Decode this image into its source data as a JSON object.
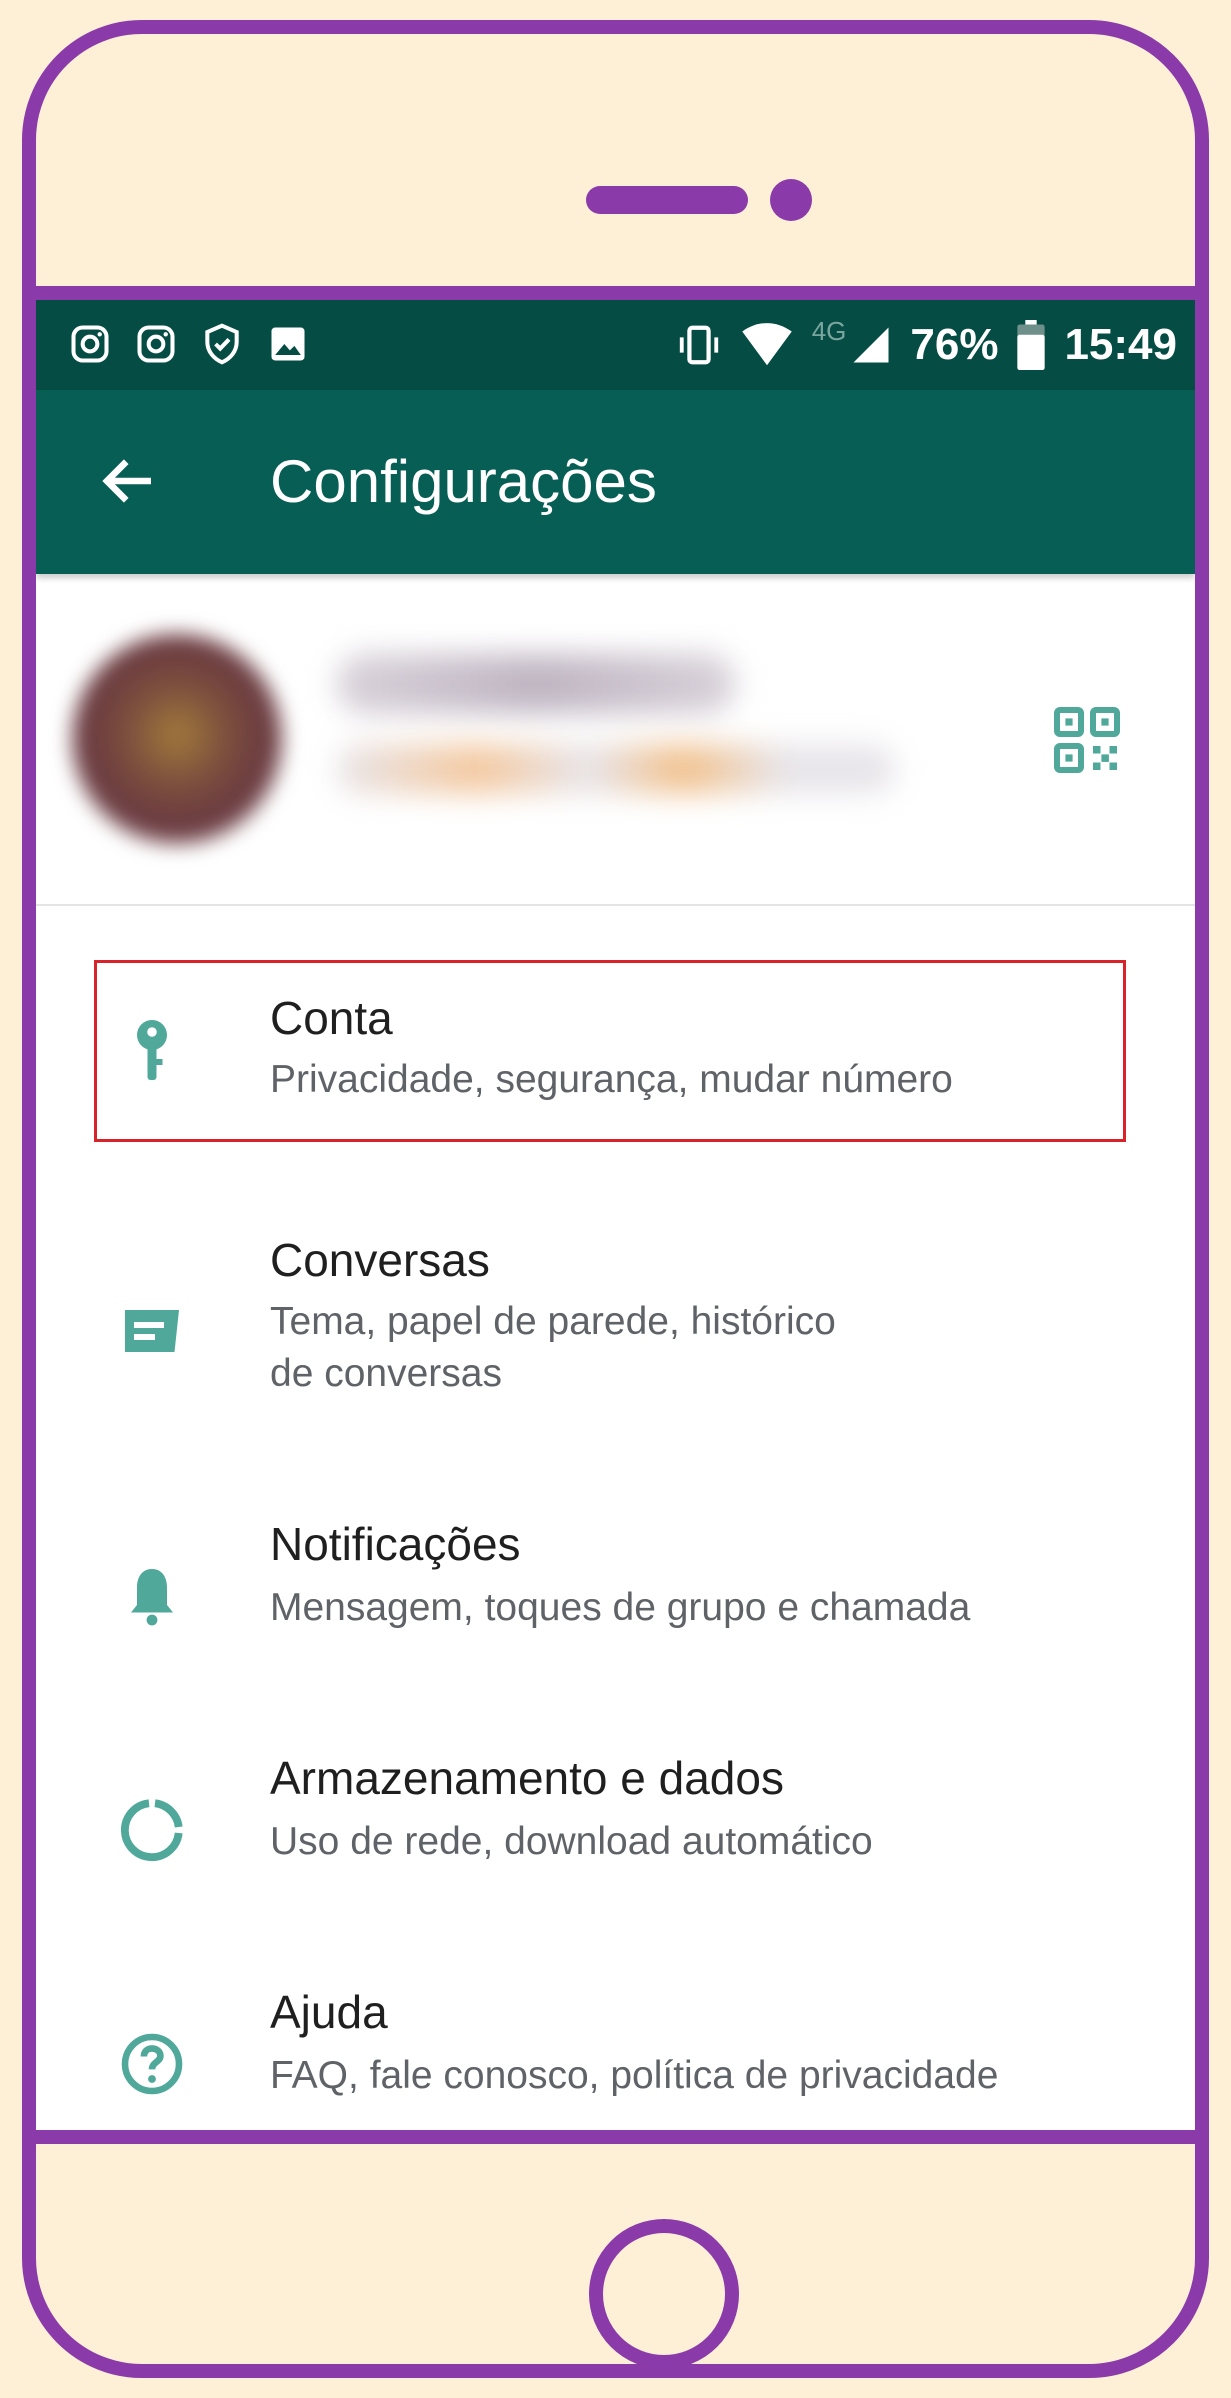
{
  "status_bar": {
    "left_icons": [
      "instagram-icon",
      "instagram-icon",
      "shield-check-icon",
      "image-icon"
    ],
    "network": "4G",
    "battery": "76%",
    "time": "15:49"
  },
  "app_bar": {
    "title": "Configurações",
    "back_icon": "arrow-back-icon"
  },
  "profile": {
    "qr_icon": "qr-code-icon"
  },
  "menu": {
    "items": [
      {
        "icon": "key-icon",
        "title": "Conta",
        "subtitle": "Privacidade, segurança, mudar número"
      },
      {
        "icon": "chat-icon",
        "title": "Conversas",
        "subtitle": "Tema, papel de parede, histórico\nde conversas"
      },
      {
        "icon": "bell-icon",
        "title": "Notificações",
        "subtitle": "Mensagem, toques de grupo e chamada"
      },
      {
        "icon": "data-usage-icon",
        "title": "Armazenamento e dados",
        "subtitle": "Uso de rede, download automático"
      },
      {
        "icon": "help-icon",
        "title": "Ajuda",
        "subtitle": "FAQ, fale conosco, política de privacidade"
      }
    ]
  },
  "colors": {
    "frame": "#8a3aa9",
    "background": "#fdf0d7",
    "status_bar": "#054d44",
    "app_bar": "#075e54",
    "icon_accent": "#4fa89a",
    "highlight": "#d8232a"
  }
}
